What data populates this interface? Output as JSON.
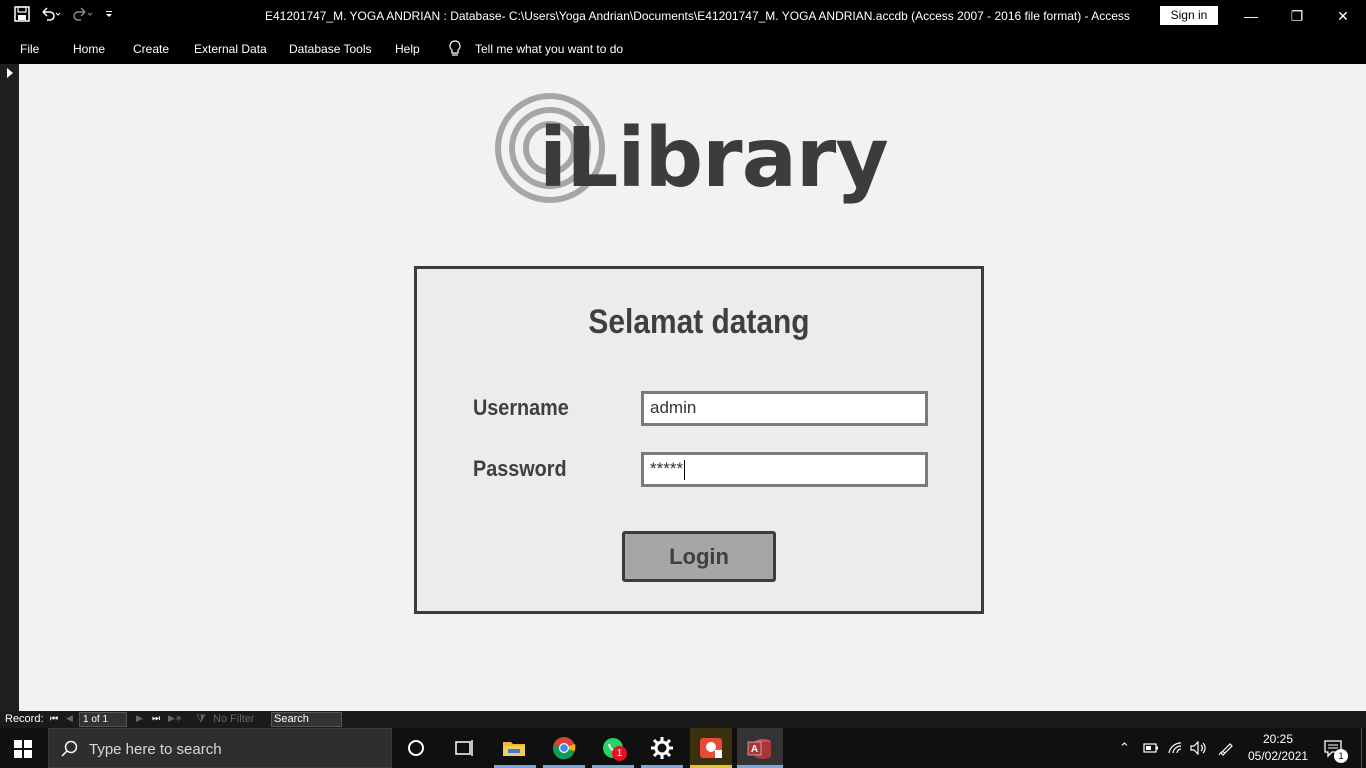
{
  "titlebar": {
    "title": "E41201747_M. YOGA ANDRIAN : Database- C:\\Users\\Yoga Andrian\\Documents\\E41201747_M. YOGA ANDRIAN.accdb (Access 2007 - 2016 file format)  -  Access",
    "sign_in": "Sign in",
    "qat_icons": [
      "save-icon",
      "undo-icon",
      "redo-icon",
      "customize-icon"
    ],
    "window_controls": [
      "minimize-icon",
      "restore-icon",
      "close-icon"
    ]
  },
  "menu": {
    "file": "File",
    "home": "Home",
    "create": "Create",
    "external_data": "External Data",
    "database_tools": "Database Tools",
    "help": "Help",
    "tell_me": "Tell me what you want to do"
  },
  "form": {
    "logo_text": "iLibrary",
    "welcome": "Selamat datang",
    "username_label": "Username",
    "username_value": "admin",
    "password_label": "Password",
    "password_value": "*****",
    "login_button": "Login"
  },
  "statusbar": {
    "record_label": "Record:",
    "record_position": "1 of 1",
    "filter": "No Filter",
    "search": "Search"
  },
  "taskbar": {
    "search_placeholder": "Type here to search",
    "whatsapp_badge": "1",
    "time": "20:25",
    "date": "05/02/2021",
    "notification_count": "1",
    "apps": [
      "task-view-icon",
      "file-explorer-icon",
      "chrome-icon",
      "whatsapp-icon",
      "settings-icon",
      "photo-app-icon",
      "access-icon"
    ],
    "colors": {
      "taskbar": "#101010",
      "active_indicator": "#7aa7d8",
      "access": "#a4373a"
    }
  }
}
